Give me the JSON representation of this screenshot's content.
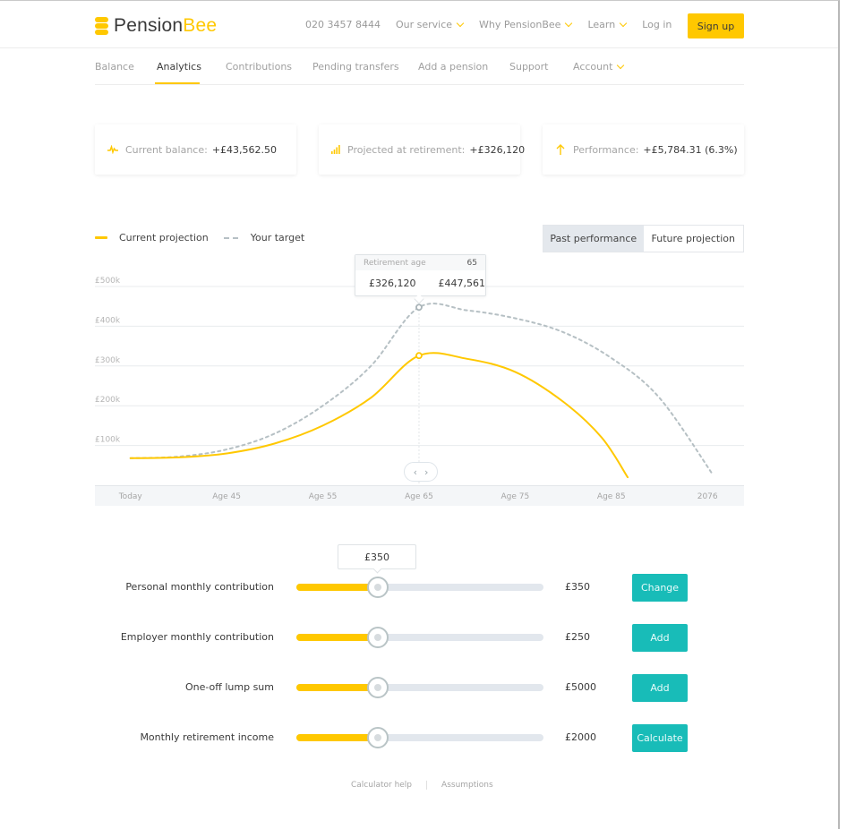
{
  "brand": {
    "name_part1": "Pension",
    "name_part2": "Bee",
    "accent": "#ffc800",
    "teal": "#18bcb8"
  },
  "header": {
    "phone": "020 3457 8444",
    "menu": [
      {
        "label": "Our service",
        "has_dropdown": true
      },
      {
        "label": "Why PensionBee",
        "has_dropdown": true
      },
      {
        "label": "Learn",
        "has_dropdown": true
      },
      {
        "label": "Log in",
        "has_dropdown": false
      }
    ],
    "signup_label": "Sign up"
  },
  "subnav": {
    "tabs": [
      {
        "label": "Balance",
        "active": false
      },
      {
        "label": "Analytics",
        "active": true
      },
      {
        "label": "Contributions",
        "active": false
      },
      {
        "label": "Pending transfers",
        "active": false
      },
      {
        "label": "Add a pension",
        "active": false
      },
      {
        "label": "Support",
        "active": false
      },
      {
        "label": "Account",
        "active": false,
        "has_dropdown": true
      }
    ]
  },
  "stats": [
    {
      "icon": "activity-pulse-icon",
      "label": "Current balance:",
      "value": "+£43,562.50"
    },
    {
      "icon": "signal-bars-icon",
      "label": "Projected at retirement:",
      "value": "+£326,120"
    },
    {
      "icon": "arrow-up-icon",
      "label": "Performance:",
      "value": "+£5,784.31 (6.3%)"
    }
  ],
  "legend": {
    "current": "Current projection",
    "target": "Your target"
  },
  "view_toggle": {
    "options": [
      "Past performance",
      "Future projection"
    ],
    "selected": "Past performance"
  },
  "tooltip": {
    "title": "Retirement age",
    "age": "65",
    "current_value": "£326,120",
    "target_value": "£447,561"
  },
  "chart_data": {
    "type": "line",
    "title": "",
    "xlabel": "",
    "ylabel": "",
    "x_tick_labels": [
      "Today",
      "Age 45",
      "Age 55",
      "Age 65",
      "Age 75",
      "Age 85",
      "2076"
    ],
    "x_tick_ages": [
      35,
      45,
      55,
      65,
      75,
      85,
      95
    ],
    "y_tick_labels": [
      "£100k",
      "£200k",
      "£300k",
      "£400k",
      "£500k"
    ],
    "y_ticks": [
      100000,
      200000,
      300000,
      400000,
      500000
    ],
    "xlim": [
      31.3,
      98.8
    ],
    "ylim": [
      0,
      500000
    ],
    "grid": true,
    "legend_position": "top-left",
    "highlight_age": 65,
    "series": [
      {
        "name": "Current projection",
        "style": "solid",
        "color": "#ffc800",
        "x": [
          35,
          40,
          45,
          50,
          55,
          60,
          65,
          70,
          75,
          80,
          84,
          86.7
        ],
        "y": [
          68000,
          70000,
          80000,
          105000,
          150000,
          220000,
          326120,
          318000,
          285000,
          210000,
          120000,
          20000
        ]
      },
      {
        "name": "Your target",
        "style": "dashed",
        "color": "#b6c0c4",
        "x": [
          35,
          40,
          45,
          50,
          55,
          60,
          65,
          70,
          75,
          80,
          85,
          90,
          95.6
        ],
        "y": [
          68000,
          72000,
          90000,
          130000,
          200000,
          300000,
          447561,
          440000,
          420000,
          385000,
          320000,
          220000,
          25000
        ]
      }
    ]
  },
  "calculator": {
    "bubble_value": "£350",
    "rows": [
      {
        "label": "Personal monthly contribution",
        "value": "£350",
        "fill_fraction": 0.33,
        "button": "Change"
      },
      {
        "label": "Employer monthly contribution",
        "value": "£250",
        "fill_fraction": 0.33,
        "button": "Add"
      },
      {
        "label": "One-off lump sum",
        "value": "£5000",
        "fill_fraction": 0.33,
        "button": "Add"
      },
      {
        "label": "Monthly retirement income",
        "value": "£2000",
        "fill_fraction": 0.33,
        "button": "Calculate"
      }
    ]
  },
  "footer_links": [
    "Calculator help",
    "Assumptions"
  ]
}
